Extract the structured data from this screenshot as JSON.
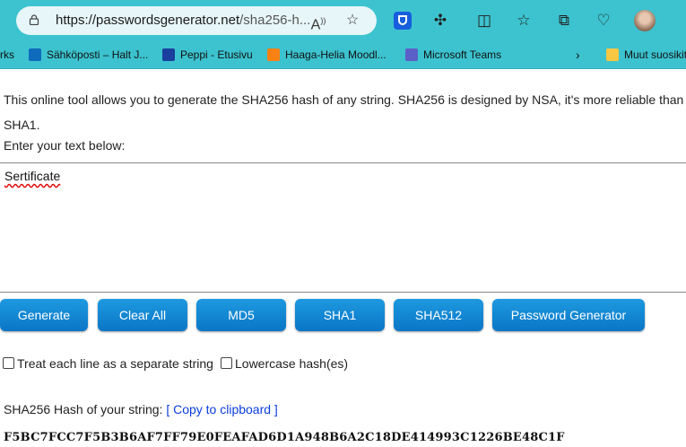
{
  "browser": {
    "url_main": "https://passwordsgenerator.net",
    "url_rest": "/sha256-h...",
    "bookmarks": [
      {
        "label": "rks",
        "color": ""
      },
      {
        "label": "Sähköposti – Halt J...",
        "color": "#0f6cbd"
      },
      {
        "label": "Peppi - Etusivu",
        "color": "#1a3f9e"
      },
      {
        "label": "Haaga-Helia Moodl...",
        "color": "#f98012"
      },
      {
        "label": "Microsoft Teams",
        "color": "#5b5fc7"
      },
      {
        "label": "Muut suosikit",
        "color": "#f6c743"
      }
    ]
  },
  "page": {
    "description": "This online tool allows you to generate the SHA256 hash of any string. SHA256 is designed by NSA, it's more reliable than SHA1.",
    "enter_label": "Enter your text below:",
    "input_text": "Sertificate",
    "buttons": {
      "generate": "Generate",
      "clear_all": "Clear All",
      "md5": "MD5",
      "sha1": "SHA1",
      "sha512": "SHA512",
      "password_generator": "Password Generator"
    },
    "options": {
      "separate_lines": "Treat each line as a separate string",
      "lowercase": "Lowercase hash(es)"
    },
    "hash_label": "SHA256 Hash of your string:",
    "copy_link": "[ Copy to clipboard ]",
    "hash_value": "F5BC7FCC7F5B3B6AF7FF79E0FEAFAD6D1A948B6A2C18DE414993C1226BE48C1F"
  }
}
